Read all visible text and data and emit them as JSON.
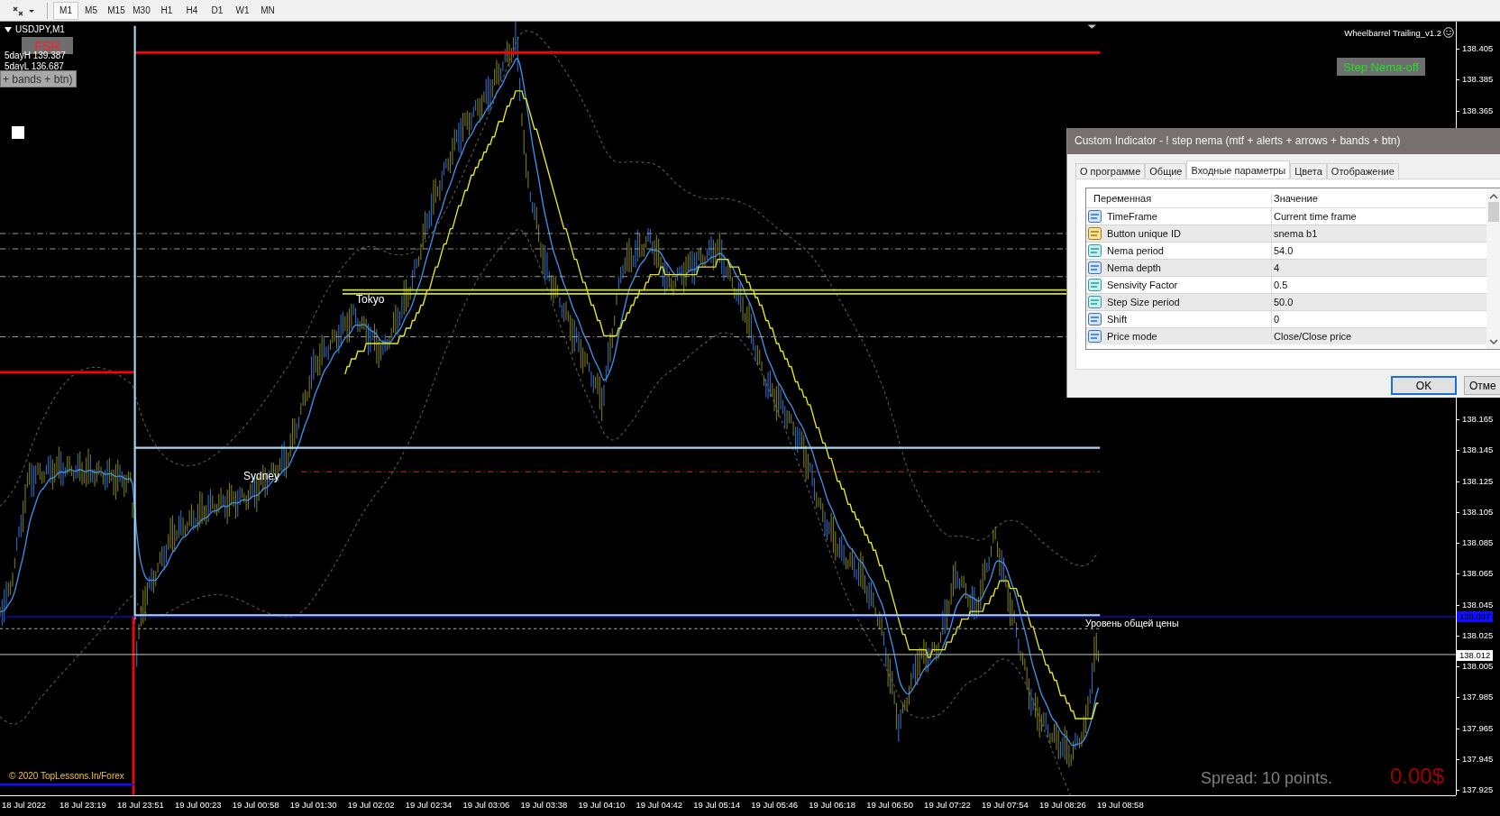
{
  "toolbar": {
    "timeframes": [
      {
        "label": "M1",
        "selected": true
      },
      {
        "label": "M5",
        "selected": false
      },
      {
        "label": "M15",
        "selected": false
      },
      {
        "label": "M30",
        "selected": false
      },
      {
        "label": "H1",
        "selected": false
      },
      {
        "label": "H4",
        "selected": false
      },
      {
        "label": "D1",
        "selected": false
      },
      {
        "label": "W1",
        "selected": false
      },
      {
        "label": "MN",
        "selected": false
      }
    ]
  },
  "chart": {
    "symbol": "USDJPY,M1",
    "fsr_button": "FSR",
    "day_high": "5dayH 139.387",
    "day_low": "5dayL 136.687",
    "indicator_button": "+ bands + btn)",
    "expert_name": "Wheelbarrel Trailing_v1.2",
    "step_button": "Step Nema-off",
    "session_labels": [
      "Tokyo",
      "Sydney"
    ],
    "price_level_label": "Уровень общей цены",
    "copyright": "© 2020 TopLessons.In/Forex",
    "spread": "Spread: 10 points.",
    "profit": "0.00$"
  },
  "price_axis": {
    "labels": [
      "138.405",
      "138.385",
      "138.365",
      "138.165",
      "138.145",
      "138.125",
      "138.105",
      "138.085",
      "138.065",
      "138.045",
      "138.025",
      "138.005",
      "137.985",
      "137.965",
      "137.945",
      "137.925"
    ],
    "bid_tag": "138.037",
    "last_tag": "138.012"
  },
  "time_axis": {
    "labels": [
      "18 Jul 2022",
      "18 Jul 23:19",
      "18 Jul 23:51",
      "19 Jul 00:23",
      "19 Jul 00:58",
      "19 Jul 01:30",
      "19 Jul 02:02",
      "19 Jul 02:34",
      "19 Jul 03:06",
      "19 Jul 03:38",
      "19 Jul 04:10",
      "19 Jul 04:42",
      "19 Jul 05:14",
      "19 Jul 05:46",
      "19 Jul 06:18",
      "19 Jul 06:50",
      "19 Jul 07:22",
      "19 Jul 07:54",
      "19 Jul 08:26",
      "19 Jul 08:58"
    ]
  },
  "dialog": {
    "title": "Custom Indicator - ! step nema (mtf + alerts + arrows + bands + btn)",
    "tabs": [
      {
        "label": "О программе",
        "selected": false
      },
      {
        "label": "Общие",
        "selected": false
      },
      {
        "label": "Входные параметры",
        "selected": true
      },
      {
        "label": "Цвета",
        "selected": false
      },
      {
        "label": "Отображение",
        "selected": false
      }
    ],
    "columns": [
      "Переменная",
      "Значение"
    ],
    "rows": [
      {
        "kind": "int",
        "name": "TimeFrame",
        "value": "Current time frame"
      },
      {
        "kind": "string",
        "name": "Button unique ID",
        "value": "snema b1"
      },
      {
        "kind": "double",
        "name": "Nema period",
        "value": "54.0"
      },
      {
        "kind": "int",
        "name": "Nema depth",
        "value": "4"
      },
      {
        "kind": "double",
        "name": "Sensivity Factor",
        "value": "0.5"
      },
      {
        "kind": "double",
        "name": "Step Size period",
        "value": "50.0"
      },
      {
        "kind": "int",
        "name": "Shift",
        "value": "0"
      },
      {
        "kind": "int",
        "name": "Price mode",
        "value": "Close/Close price"
      }
    ],
    "buttons": [
      {
        "label": "OK",
        "default": true
      },
      {
        "label": "Отме",
        "default": false
      }
    ]
  }
}
